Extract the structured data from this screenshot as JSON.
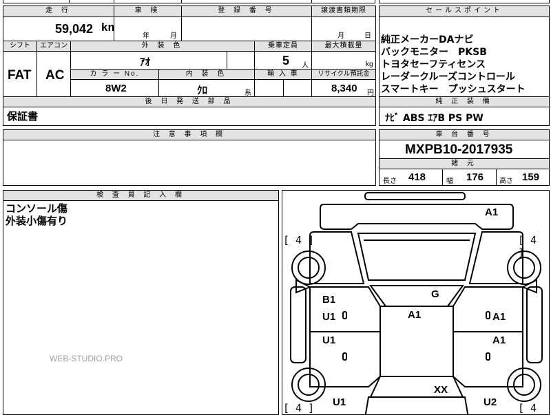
{
  "header": {
    "mileage_label": "走 行",
    "inspection_label": "車 検",
    "registration_label": "登 録 番 号",
    "transfer_deadline_label": "譲渡書類期限",
    "sales_point_label": "セールスポイント"
  },
  "mileage": {
    "value": "59,042",
    "unit": "km"
  },
  "inspection": {
    "year_unit": "年",
    "month_unit": "月"
  },
  "transfer": {
    "month_unit": "月",
    "day_unit": "日"
  },
  "row2_labels": {
    "shift": "シフト",
    "aircon": "エアコン",
    "exterior_color": "外 装 色",
    "capacity": "乗車定員",
    "max_load": "最大積載量"
  },
  "shift_value": "FAT",
  "aircon_value": "AC",
  "exterior_color_value": "ｱｵ",
  "capacity": {
    "value": "5",
    "unit": "人"
  },
  "max_load_unit": "kg",
  "row3_labels": {
    "color_no": "カ ラ ー No.",
    "interior_color": "内 装 色",
    "import": "輸 入 車",
    "recycle": "リサイクル預託金"
  },
  "color_no_value": "8W2",
  "interior_color_value": "ｸﾛ",
  "interior_suffix": "系",
  "recycle": {
    "value": "8,340",
    "unit": "円"
  },
  "later_parts_label": "後 日 発 送 部 品",
  "later_parts_value": "保証書",
  "sales_points": [
    "純正メーカーDAナビ",
    "バックモニター　PKSB",
    "トヨタセーフティセンス",
    "レーダークルーズコントロール",
    "スマートキー　プッシュスタート"
  ],
  "standard_equipment_label": "純 正 装 備",
  "standard_equipment_value": "ﾅﾋﾞ ABS ｴｱB PS PW",
  "notes_label": "注 意 事 項 欄",
  "chassis_label": "車 台 番 号",
  "chassis_value": "MXPB10-2017935",
  "specs_label": "諸 元",
  "specs": {
    "length_label": "長さ",
    "length_value": "418",
    "width_label": "幅",
    "width_value": "176",
    "height_label": "高さ",
    "height_value": "159"
  },
  "inspector_label": "検 査 員 記 入 欄",
  "inspector_notes": [
    "コンソール傷",
    "外装小傷有り"
  ],
  "watermark": "WEB-STUDIO.PRO",
  "diagram_marks": {
    "a1_top_right": "A1",
    "b1_left": "B1",
    "u1_left_upper": "U1",
    "g_center": "G",
    "a1_center": "A1",
    "a1_right_upper": "A1",
    "u1_left_lower": "U1",
    "a1_right_lower": "A1",
    "xx_center": "XX",
    "u1_bottom_left": "U1",
    "u2_bottom_right": "U2"
  },
  "tire_brackets": {
    "top_left": "[ 4 ]",
    "top_right": "[ 4 ]",
    "bottom_left": "[ 4 ]",
    "bottom_right": "[ 4 ]"
  },
  "colors": {
    "header_bg": "#e3e3e3",
    "line": "#000000",
    "watermark": "#a0a0a0"
  }
}
